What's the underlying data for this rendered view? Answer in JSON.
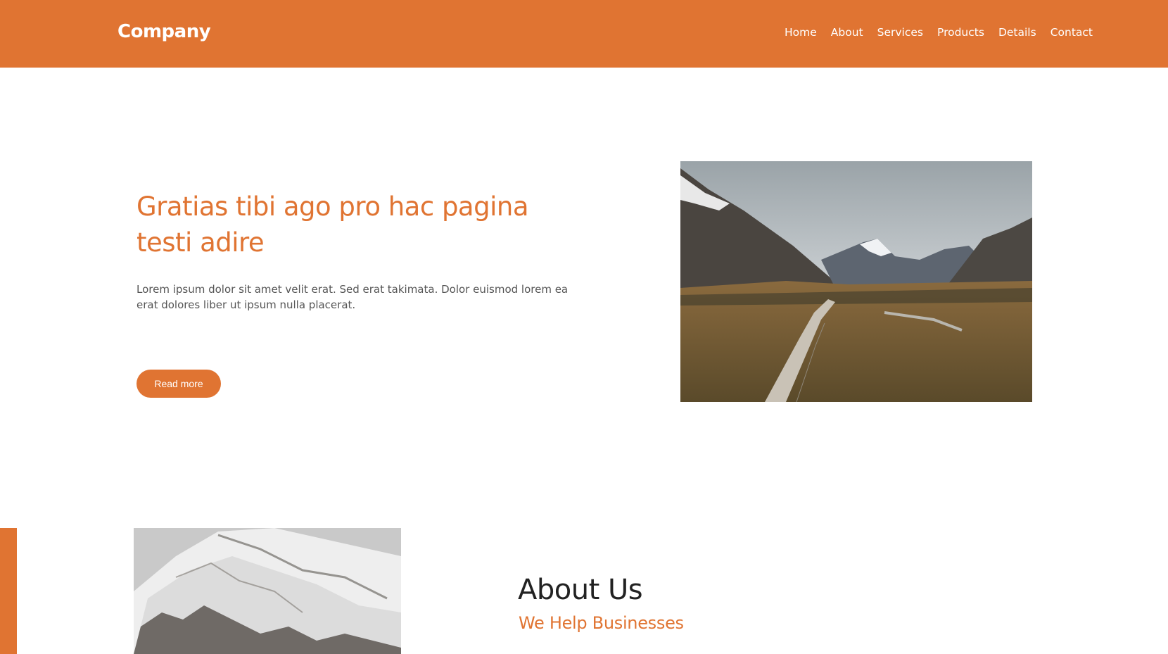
{
  "header": {
    "brand": "Company",
    "nav": [
      "Home",
      "About",
      "Services",
      "Products",
      "Details",
      "Contact"
    ]
  },
  "hero": {
    "title": "Gratias tibi ago pro hac pagina testi adire",
    "text": "Lorem ipsum dolor sit amet velit erat. Sed erat takimata. Dolor euismod lorem ea erat dolores liber ut ipsum nulla placerat.",
    "button_label": "Read more",
    "image_alt": "mountain-valley-boardwalk"
  },
  "about": {
    "title": "About Us",
    "subtitle": "We Help Businesses",
    "image_alt": "snowy-mountain-slope"
  },
  "colors": {
    "accent": "#e07432",
    "text_dark": "#222222",
    "text_muted": "#555555",
    "background": "#ffffff"
  }
}
